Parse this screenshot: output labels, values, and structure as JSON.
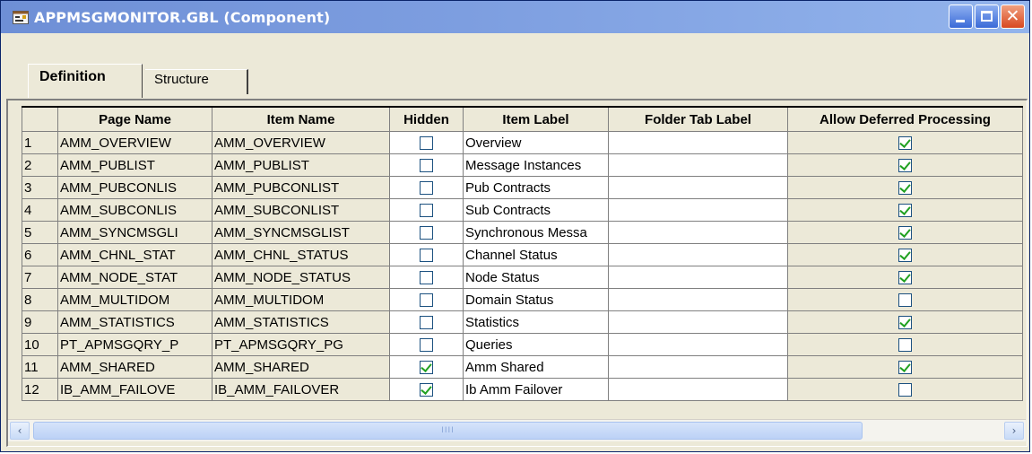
{
  "window": {
    "title": "APPMSGMONITOR.GBL (Component)",
    "minimize_icon": "minimize-icon",
    "maximize_icon": "maximize-icon",
    "close_icon": "close-icon",
    "close_glyph": "✕"
  },
  "tabs": [
    {
      "label": "Definition",
      "active": true
    },
    {
      "label": "Structure",
      "active": false
    }
  ],
  "columns": [
    "Page Name",
    "Item Name",
    "Hidden",
    "Item Label",
    "Folder Tab Label",
    "Allow Deferred Processing"
  ],
  "rows": [
    {
      "num": "1",
      "page_name": "AMM_OVERVIEW",
      "item_name": "AMM_OVERVIEW",
      "hidden": false,
      "item_label": "Overview",
      "folder_tab_label": "",
      "allow_deferred": true
    },
    {
      "num": "2",
      "page_name": "AMM_PUBLIST",
      "item_name": "AMM_PUBLIST",
      "hidden": false,
      "item_label": "Message Instances",
      "folder_tab_label": "",
      "allow_deferred": true
    },
    {
      "num": "3",
      "page_name": "AMM_PUBCONLIS",
      "item_name": "AMM_PUBCONLIST",
      "hidden": false,
      "item_label": "Pub Contracts",
      "folder_tab_label": "",
      "allow_deferred": true
    },
    {
      "num": "4",
      "page_name": "AMM_SUBCONLIS",
      "item_name": "AMM_SUBCONLIST",
      "hidden": false,
      "item_label": "Sub Contracts",
      "folder_tab_label": "",
      "allow_deferred": true
    },
    {
      "num": "5",
      "page_name": "AMM_SYNCMSGLI",
      "item_name": "AMM_SYNCMSGLIST",
      "hidden": false,
      "item_label": "Synchronous Messa",
      "folder_tab_label": "",
      "allow_deferred": true
    },
    {
      "num": "6",
      "page_name": "AMM_CHNL_STAT",
      "item_name": "AMM_CHNL_STATUS",
      "hidden": false,
      "item_label": "Channel Status",
      "folder_tab_label": "",
      "allow_deferred": true
    },
    {
      "num": "7",
      "page_name": "AMM_NODE_STAT",
      "item_name": "AMM_NODE_STATUS",
      "hidden": false,
      "item_label": "Node Status",
      "folder_tab_label": "",
      "allow_deferred": true
    },
    {
      "num": "8",
      "page_name": "AMM_MULTIDOM",
      "item_name": "AMM_MULTIDOM",
      "hidden": false,
      "item_label": "Domain Status",
      "folder_tab_label": "",
      "allow_deferred": false
    },
    {
      "num": "9",
      "page_name": "AMM_STATISTICS",
      "item_name": "AMM_STATISTICS",
      "hidden": false,
      "item_label": "Statistics",
      "folder_tab_label": "",
      "allow_deferred": true
    },
    {
      "num": "10",
      "page_name": "PT_APMSGQRY_P",
      "item_name": "PT_APMSGQRY_PG",
      "hidden": false,
      "item_label": "Queries",
      "folder_tab_label": "",
      "allow_deferred": false
    },
    {
      "num": "11",
      "page_name": "AMM_SHARED",
      "item_name": "AMM_SHARED",
      "hidden": true,
      "item_label": "Amm Shared",
      "folder_tab_label": "",
      "allow_deferred": true
    },
    {
      "num": "12",
      "page_name": "IB_AMM_FAILOVE",
      "item_name": "IB_AMM_FAILOVER",
      "hidden": true,
      "item_label": "Ib Amm Failover",
      "folder_tab_label": "",
      "allow_deferred": false
    }
  ],
  "scrollbar": {
    "left_icon": "scroll-left-icon",
    "right_icon": "scroll-right-icon",
    "left_glyph": "‹",
    "right_glyph": "›",
    "grip": "IIII"
  },
  "colors": {
    "titlebar": "#7d9ee0",
    "checkmark": "#21a121"
  }
}
